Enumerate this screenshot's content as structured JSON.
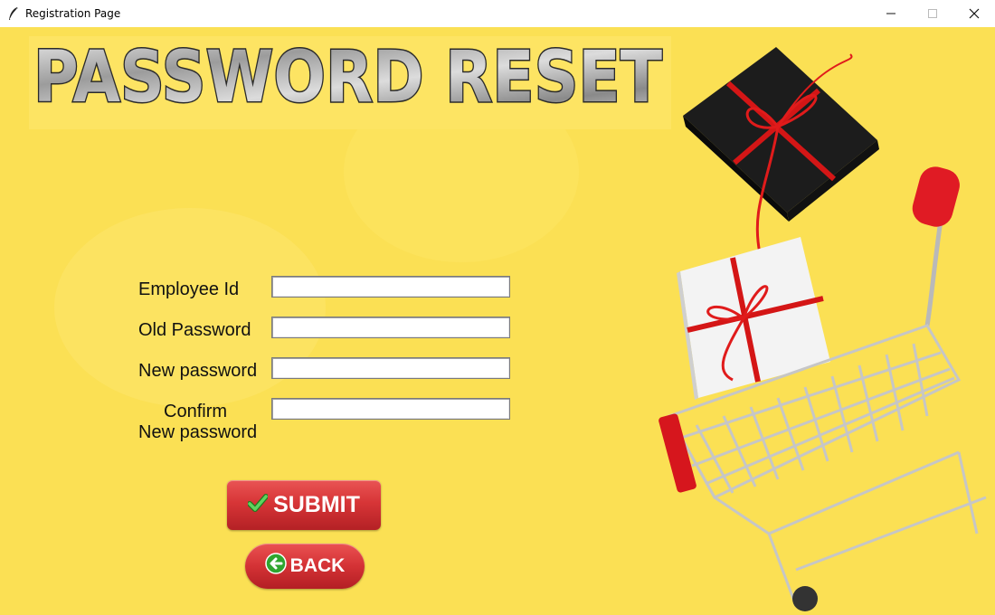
{
  "window": {
    "title": "Registration Page",
    "controls": [
      "minimize-icon",
      "maximize-icon",
      "close-icon"
    ]
  },
  "banner": {
    "text": "PASSWORD RESET"
  },
  "form": {
    "employee_id_label": "Employee Id",
    "old_password_label": "Old Password",
    "new_password_label": "New password",
    "confirm_label_line1": "Confirm",
    "confirm_label_line2": "New password",
    "employee_id_value": "",
    "old_password_value": "",
    "new_password_value": "",
    "confirm_password_value": ""
  },
  "buttons": {
    "submit_label": "SUBMIT",
    "back_label": "BACK"
  },
  "colors": {
    "background": "#fbe054",
    "button_red": "#d73537",
    "check_green": "#3cb83c"
  }
}
